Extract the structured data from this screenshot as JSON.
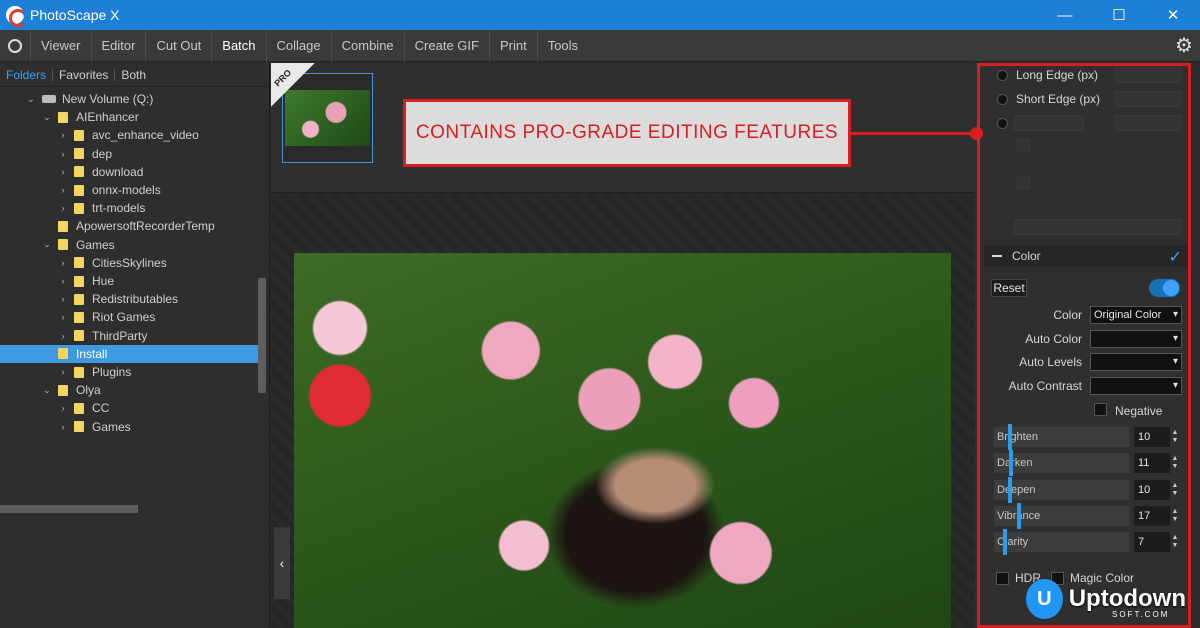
{
  "window": {
    "title": "PhotoScape X",
    "controls": [
      "—",
      "☐",
      "✕"
    ]
  },
  "menu": {
    "items": [
      "Viewer",
      "Editor",
      "Cut Out",
      "Batch",
      "Collage",
      "Combine",
      "Create GIF",
      "Print",
      "Tools"
    ],
    "active": "Batch"
  },
  "sidebar": {
    "tabs": [
      "Folders",
      "Favorites",
      "Both"
    ],
    "active_tab": "Folders",
    "tree": [
      {
        "label": "New Volume (Q:)",
        "depth": 0,
        "type": "drive",
        "expanded": true
      },
      {
        "label": "AIEnhancer",
        "depth": 1,
        "type": "folder",
        "expanded": true
      },
      {
        "label": "avc_enhance_video",
        "depth": 2,
        "type": "folder",
        "expanded": false
      },
      {
        "label": "dep",
        "depth": 2,
        "type": "folder",
        "expanded": false
      },
      {
        "label": "download",
        "depth": 2,
        "type": "folder",
        "expanded": false
      },
      {
        "label": "onnx-models",
        "depth": 2,
        "type": "folder",
        "expanded": false
      },
      {
        "label": "trt-models",
        "depth": 2,
        "type": "folder",
        "expanded": false
      },
      {
        "label": "ApowersoftRecorderTemp",
        "depth": 1,
        "type": "folder",
        "expanded": null
      },
      {
        "label": "Games",
        "depth": 1,
        "type": "folder",
        "expanded": true
      },
      {
        "label": "CitiesSkylines",
        "depth": 2,
        "type": "folder",
        "expanded": false
      },
      {
        "label": "Hue",
        "depth": 2,
        "type": "folder",
        "expanded": false
      },
      {
        "label": "Redistributables",
        "depth": 2,
        "type": "folder",
        "expanded": false
      },
      {
        "label": "Riot Games",
        "depth": 2,
        "type": "folder",
        "expanded": false
      },
      {
        "label": "ThirdParty",
        "depth": 2,
        "type": "folder",
        "expanded": false
      },
      {
        "label": "Install",
        "depth": 1,
        "type": "folder",
        "expanded": null,
        "selected": true
      },
      {
        "label": "Plugins",
        "depth": 2,
        "type": "folder",
        "expanded": false
      },
      {
        "label": "Olya",
        "depth": 1,
        "type": "folder",
        "expanded": true
      },
      {
        "label": "CC",
        "depth": 2,
        "type": "folder",
        "expanded": false
      },
      {
        "label": "Games",
        "depth": 2,
        "type": "folder",
        "expanded": false
      }
    ]
  },
  "thumbnail": {
    "badge": "PRO"
  },
  "callout": {
    "text": "CONTAINS PRO-GRADE EDITING FEATURES",
    "color": "#d81e1e"
  },
  "resize": {
    "options": [
      "Long Edge (px)",
      "Short Edge (px)"
    ]
  },
  "color_panel": {
    "title": "Color",
    "reset_label": "Reset",
    "enabled": true,
    "fields": [
      {
        "label": "Color",
        "value": "Original Color"
      },
      {
        "label": "Auto Color",
        "value": ""
      },
      {
        "label": "Auto Levels",
        "value": ""
      },
      {
        "label": "Auto Contrast",
        "value": ""
      }
    ],
    "negative_label": "Negative",
    "sliders": [
      {
        "label": "Brighten",
        "value": 10
      },
      {
        "label": "Darken",
        "value": 11
      },
      {
        "label": "Deepen",
        "value": 10
      },
      {
        "label": "Vibrance",
        "value": 17
      },
      {
        "label": "Clarity",
        "value": 7
      }
    ],
    "hdr_label": "HDR",
    "magic_label": "Magic Color"
  },
  "watermark": {
    "logo": "U",
    "text": "Uptodown",
    "sub": "SOFT.COM"
  },
  "colors": {
    "accent": "#3da2ff",
    "titlebar": "#1e7fd6",
    "highlight": "#d81e1e"
  }
}
